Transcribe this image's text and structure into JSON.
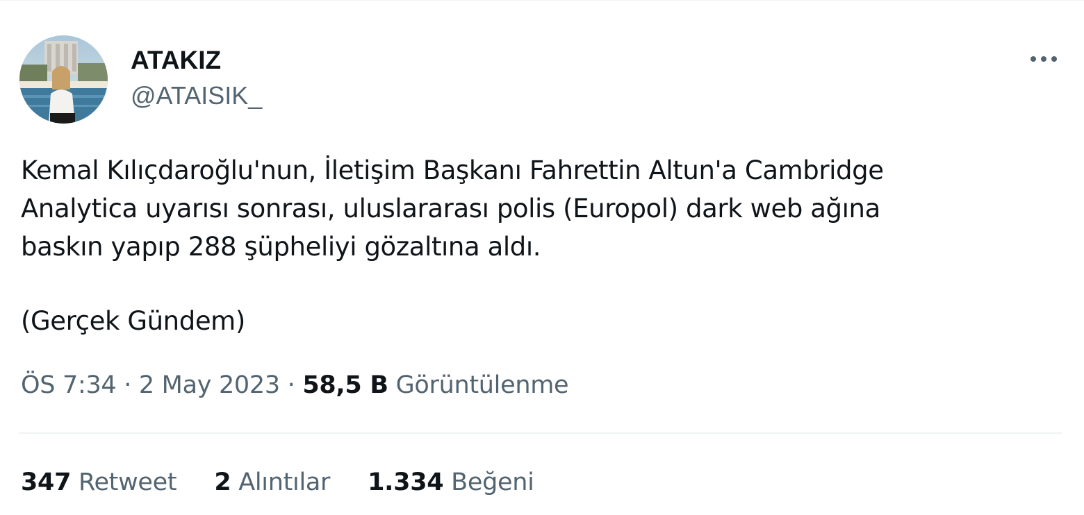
{
  "author": {
    "display_name": "ATAKIZ",
    "handle": "@ATAISIK_"
  },
  "tweet": {
    "lines": [
      "Kemal Kılıçdaroğlu'nun, İletişim Başkanı Fahrettin Altun'a Cambridge",
      "Analytica uyarısı sonrası, uluslararası polis (Europol) dark web ağına",
      "baskın yapıp 288 şüpheliyi gözaltına aldı."
    ],
    "source_line": "(Gerçek Gündem)"
  },
  "meta": {
    "time": "ÖS 7:34",
    "separator": "·",
    "date": "2 May 2023",
    "views_count": "58,5 B",
    "views_label": "Görüntülenme"
  },
  "stats": {
    "retweets_count": "347",
    "retweets_label": "Retweet",
    "quotes_count": "2",
    "quotes_label": "Alıntılar",
    "likes_count": "1.334",
    "likes_label": "Beğeni"
  },
  "icons": {
    "more": "more-dots-icon"
  },
  "colors": {
    "text_primary": "#0f1419",
    "text_secondary": "#536471",
    "divider": "#eff3f4"
  }
}
